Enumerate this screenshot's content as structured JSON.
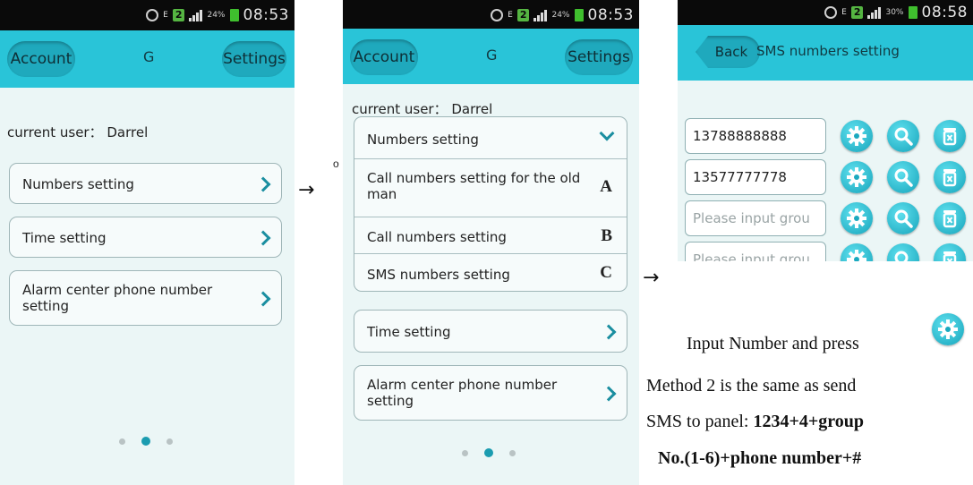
{
  "status_bar": {
    "time_1": "08:53",
    "time_2": "08:53",
    "time_3": "08:58",
    "battery_1": "24%",
    "battery_2": "24%",
    "battery_3": "30%",
    "sim_badge": "2",
    "sim_small": "E\n1"
  },
  "screen1": {
    "account_btn": "Account",
    "title": "G",
    "settings_btn": "Settings",
    "current_user": "current user： Darrel",
    "menu": [
      "Numbers setting",
      "Time setting",
      "Alarm center phone number setting"
    ]
  },
  "screen2": {
    "account_btn": "Account",
    "title": "G",
    "settings_btn": "Settings",
    "current_user": "current user： Darrel",
    "numbers_header": "Numbers setting",
    "submenu": [
      {
        "label": "Call numbers setting for the old man",
        "letter": "A"
      },
      {
        "label": "Call numbers setting",
        "letter": "B"
      },
      {
        "label": "SMS numbers setting",
        "letter": "C"
      }
    ],
    "time_setting": "Time setting",
    "alarm_setting": "Alarm center phone number setting",
    "left_fragment": "o"
  },
  "screen3": {
    "back_btn": "Back",
    "title": "SMS numbers setting",
    "rows": [
      {
        "value": "13788888888",
        "placeholder": ""
      },
      {
        "value": "13577777778",
        "placeholder": ""
      },
      {
        "value": "",
        "placeholder": "Please input grou"
      },
      {
        "value": "",
        "placeholder": "Please input grou"
      }
    ]
  },
  "arrows": [
    "→",
    "→"
  ],
  "caption": {
    "line1": "Input Number and press",
    "line2": "Method 2 is the same as send",
    "line3_plain": "SMS to panel: ",
    "line3_bold": "1234+4+group",
    "line4_bold": "No.(1-6)+phone number+#"
  },
  "icons": {
    "settings": "gear-icon",
    "search": "magnifier-icon",
    "delete": "trash-icon"
  },
  "colors": {
    "header": "#29c4d8",
    "accent": "#1a8ea0",
    "status_bar": "#0a0a0a",
    "screen_bg": "#ebf6f6"
  }
}
